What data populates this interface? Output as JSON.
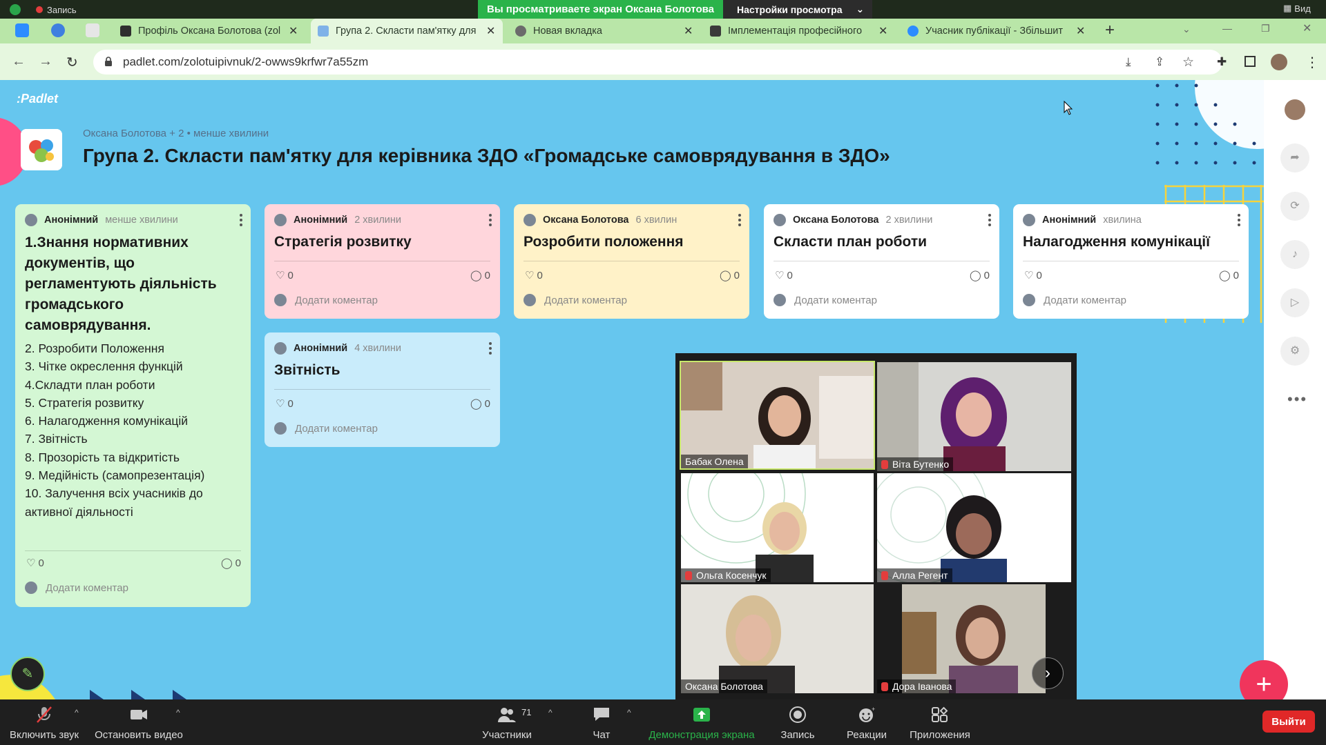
{
  "zoom_top": {
    "recording": "Запись",
    "viewing_banner": "Вы просматриваете экран Оксана Болотова",
    "view_options": "Настройки просмотра",
    "view_button": "Вид"
  },
  "browser": {
    "tabs": [
      {
        "title": "Профіль Оксана Болотова (zol",
        "color": "#2f2f2f",
        "active": false
      },
      {
        "title": "Група 2. Скласти пам'ятку для",
        "color": "#7fb2e8",
        "active": true
      },
      {
        "title": "Новая вкладка",
        "color": "#6b6b6b",
        "active": false
      },
      {
        "title": "Імплементація професійного",
        "color": "#3a3a3a",
        "active": false
      },
      {
        "title": "Учасник публікації - Збільшит",
        "color": "#2d8cff",
        "active": false
      }
    ],
    "url": "padlet.com/zolotuipivnuk/2-owws9krfwr7a55zm"
  },
  "padlet": {
    "logo": ":Padlet",
    "meta": "Оксана Болотова  + 2  • менше хвилини",
    "title": "Група 2. Скласти пам'ятку для керівника ЗДО «Громадське самоврядування в ЗДО»",
    "add_comment": "Додати коментар",
    "cards": [
      {
        "author": "Анонімний",
        "time": "менше хвилини",
        "title_lines": [
          "1.Знання нормативних",
          "документів, що",
          "регламентують діяльність",
          "громадського",
          "самоврядування."
        ],
        "items": [
          "2. Розробити Положення",
          "3. Чітке окреслення функцій",
          "4.Складти план роботи",
          "5. Стратегія розвитку",
          "6. Налагодження комунікацій",
          "7. Звітність",
          "8. Прозорість та відкритість",
          "9. Медійність (самопрезентація)",
          "10. Залучення всіх учасників до",
          "активної діяльності"
        ],
        "likes": "0",
        "comments": "0",
        "bg": "#d4f7d4"
      },
      {
        "author": "Анонімний",
        "time": "2 хвилини",
        "title": "Стратегія розвитку",
        "likes": "0",
        "comments": "0",
        "bg": "#ffd6dc"
      },
      {
        "author": "Оксана Болотова",
        "time": "6 хвилин",
        "title": "Розробити положення",
        "likes": "0",
        "comments": "0",
        "bg": "#fff2c8"
      },
      {
        "author": "Оксана Болотова",
        "time": "2 хвилини",
        "title": "Скласти план роботи",
        "likes": "0",
        "comments": "0",
        "bg": "#ffffff"
      },
      {
        "author": "Анонімний",
        "time": "хвилина",
        "title": "Налагодження комунікації",
        "likes": "0",
        "comments": "0",
        "bg": "#ffffff"
      },
      {
        "author": "Анонімний",
        "time": "4 хвилини",
        "title": "Звітність",
        "likes": "0",
        "comments": "0",
        "bg": "#c9ecfb"
      }
    ]
  },
  "participants": [
    {
      "name": "Бабак Олена",
      "muted": false
    },
    {
      "name": "Віта Бутенко",
      "muted": true
    },
    {
      "name": "Ольга Косенчук",
      "muted": true
    },
    {
      "name": "Алла Регент",
      "muted": true
    },
    {
      "name": "Оксана Болотова",
      "muted": false
    },
    {
      "name": "Дора Іванова",
      "muted": true
    }
  ],
  "zoom_bottom": {
    "unmute": "Включить звук",
    "stop_video": "Остановить видео",
    "participants": "Участники",
    "participants_count": "71",
    "chat": "Чат",
    "share": "Демонстрация экрана",
    "record": "Запись",
    "reactions": "Реакции",
    "apps": "Приложения",
    "leave": "Выйти"
  },
  "icons": [
    "shield-icon",
    "back-icon",
    "forward-icon",
    "reload-icon",
    "lock-icon",
    "star-icon",
    "heart-icon",
    "comment-icon",
    "more-icon",
    "plus-icon",
    "pencil-icon",
    "mic-off-icon",
    "camera-icon",
    "people-icon",
    "chat-icon",
    "share-screen-icon",
    "record-icon",
    "reaction-icon",
    "apps-icon",
    "chevron-right-icon"
  ],
  "colors": {
    "padlet_bg": "#66c6ee",
    "tab_bar": "#b9e6a8",
    "zoom_green": "#2ab34a",
    "fab": "#f0355c",
    "leave": "#e02828"
  }
}
